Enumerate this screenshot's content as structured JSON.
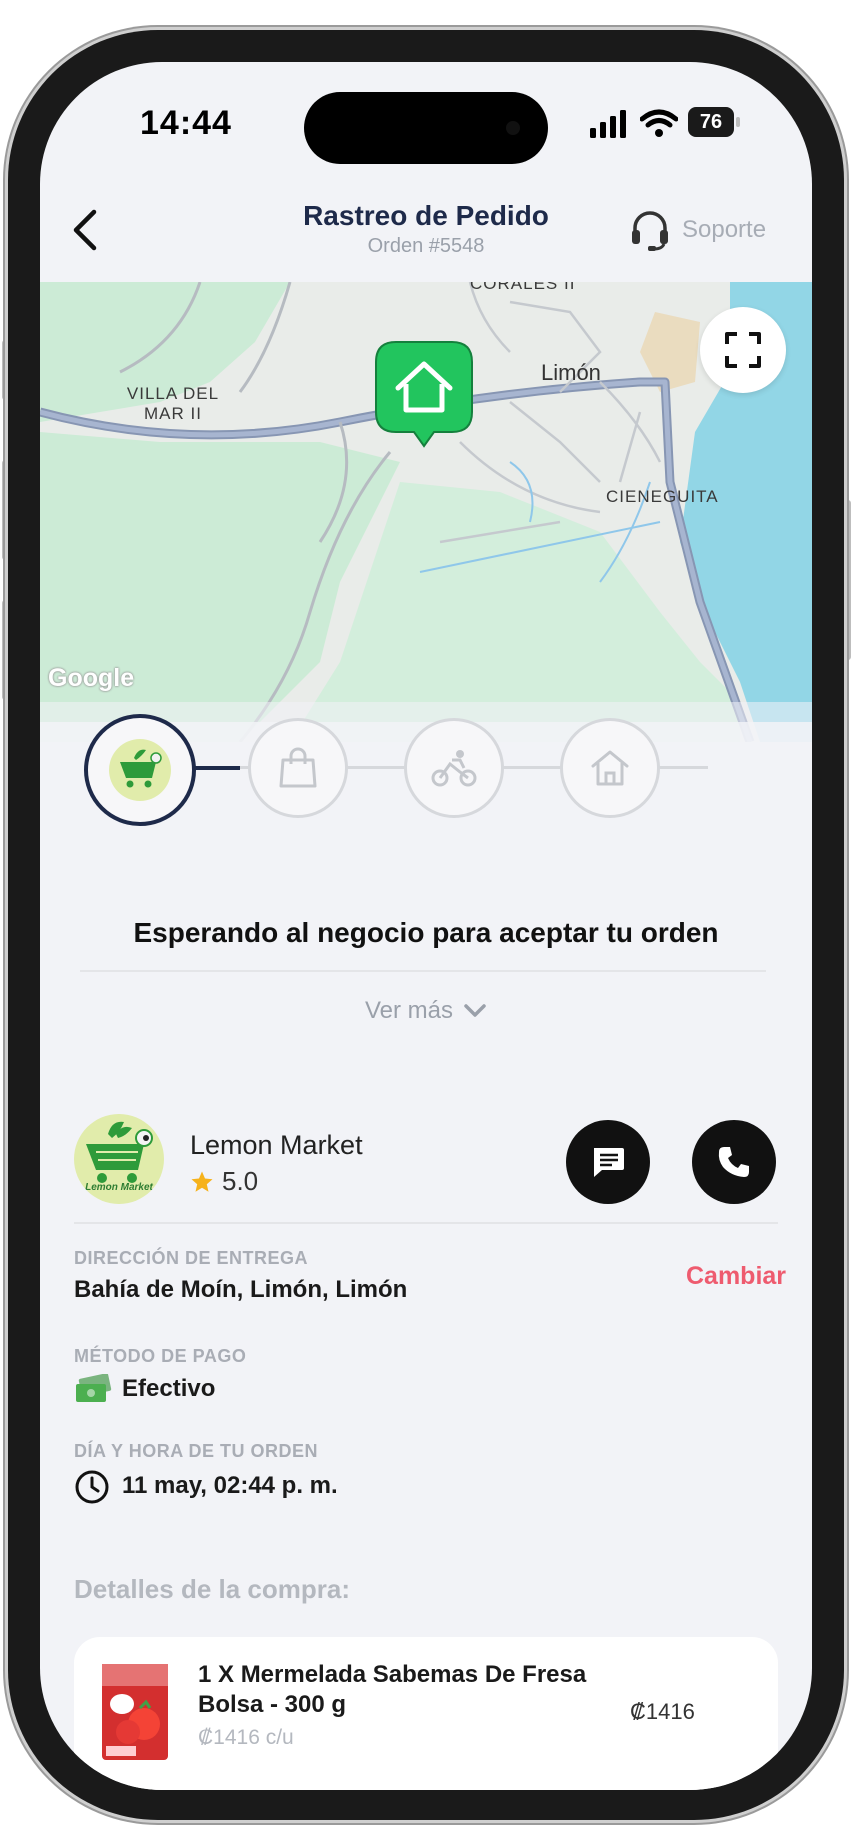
{
  "status_bar": {
    "time": "14:44",
    "battery": "76"
  },
  "header": {
    "title": "Rastreo de Pedido",
    "order_number": "Orden #5548",
    "support_label": "Soporte"
  },
  "map": {
    "labels": {
      "villa": "VILLA DEL MAR II",
      "corales": "CORALES II",
      "limon": "Limón",
      "cieneguita": "CIENEGUITA",
      "google": "Google"
    }
  },
  "progress": {
    "steps": [
      "store-logo",
      "shopping-bag-icon",
      "delivery-bike-icon",
      "home-icon"
    ],
    "active_step": 0,
    "status_text": "Esperando al negocio para aceptar tu orden"
  },
  "ver_mas_label": "Ver más",
  "store": {
    "name": "Lemon Market",
    "rating": "5.0",
    "logo_text": "Lemon Market"
  },
  "delivery": {
    "label": "DIRECCIÓN DE ENTREGA",
    "value": "Bahía de Moín, Limón, Limón",
    "change_label": "Cambiar"
  },
  "payment": {
    "label": "MÉTODO DE PAGO",
    "value": "Efectivo"
  },
  "order_time": {
    "label": "DÍA Y HORA DE TU ORDEN",
    "value": "11 may, 02:44 p. m."
  },
  "purchase": {
    "title": "Detalles de la compra:",
    "items": [
      {
        "name": "1 X Mermelada Sabemas De Fresa Bolsa - 300 g",
        "unit_price": "₡1416 c/u",
        "price": "₡1416"
      }
    ]
  },
  "colors": {
    "accent_navy": "#1e2a4a",
    "pin_green": "#22c55e",
    "change_red": "#ee5b6f"
  }
}
